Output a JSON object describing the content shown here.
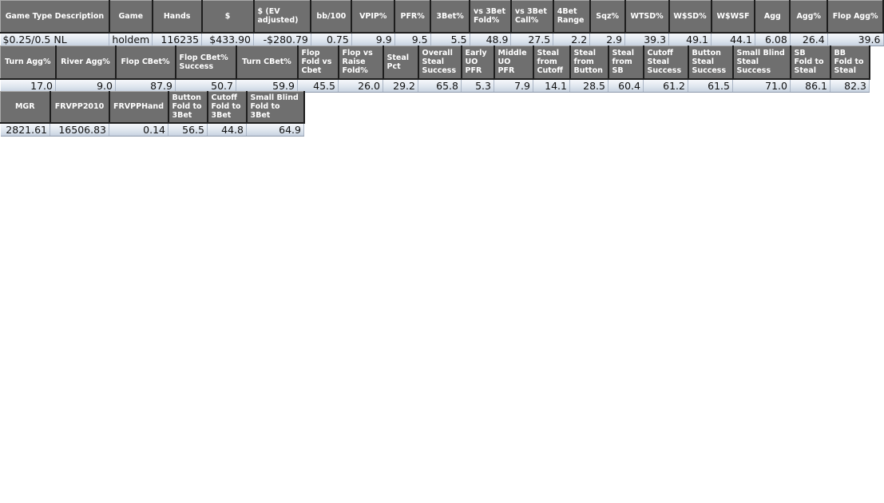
{
  "table1": {
    "headers": [
      "Game Type Description",
      "Game",
      "Hands",
      "$",
      "$ (EV adjusted)",
      "bb/100",
      "VPIP%",
      "PFR%",
      "3Bet%",
      "vs 3Bet Fold%",
      "vs 3Bet Call%",
      "4Bet Range",
      "Sqz%",
      "WTSD%",
      "W$SD%",
      "W$WSF",
      "Agg",
      "Agg%",
      "Flop Agg%"
    ],
    "values": [
      "$0.25/0.5 NL",
      "holdem",
      "116235",
      "$433.90",
      "-$280.79",
      "0.75",
      "9.9",
      "9.5",
      "5.5",
      "48.9",
      "27.5",
      "2.2",
      "2.9",
      "39.3",
      "49.1",
      "44.1",
      "6.08",
      "26.4",
      "39.6"
    ]
  },
  "table2": {
    "headers": [
      "Turn Agg%",
      "River Agg%",
      "Flop CBet%",
      "Flop CBet% Success",
      "Turn CBet%",
      "Flop Fold vs Cbet",
      "Flop vs Raise Fold%",
      "Steal Pct",
      "Overall Steal Success",
      "Early UO PFR",
      "Middle UO PFR",
      "Steal from Cutoff",
      "Steal from Button",
      "Steal from SB",
      "Cutoff Steal Success",
      "Button Steal Success",
      "Small Blind Steal Success",
      "SB Fold to Steal",
      "BB Fold to Steal"
    ],
    "values": [
      "17.0",
      "9.0",
      "87.9",
      "50.7",
      "59.9",
      "45.5",
      "26.0",
      "29.2",
      "65.8",
      "5.3",
      "7.9",
      "14.1",
      "28.5",
      "60.4",
      "61.2",
      "61.5",
      "71.0",
      "86.1",
      "82.3"
    ]
  },
  "table3": {
    "headers": [
      "MGR",
      "FRVPP2010",
      "FRVPPHand",
      "Button Fold to 3Bet",
      "Cutoff Fold to 3Bet",
      "Small Blind Fold to 3Bet"
    ],
    "values": [
      "2821.61",
      "16506.83",
      "0.14",
      "56.5",
      "44.8",
      "64.9"
    ]
  }
}
